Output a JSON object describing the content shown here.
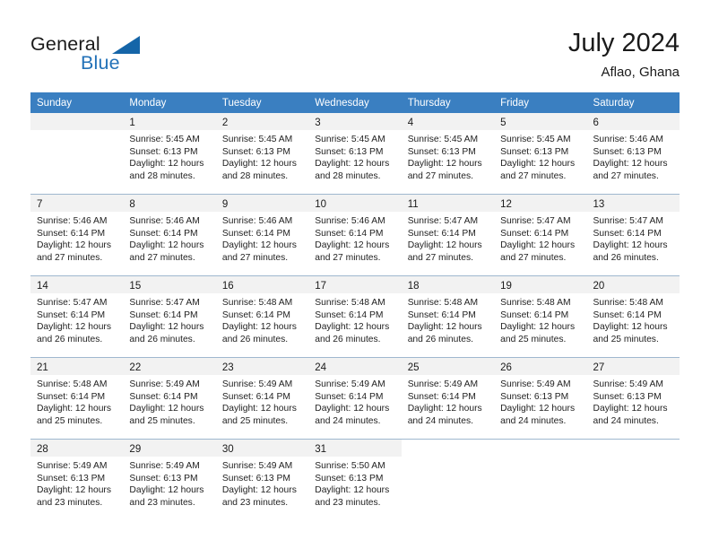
{
  "brand": {
    "word1": "General",
    "word2": "Blue",
    "logo_icon": "triangle-logo-icon",
    "accent_color": "#2372b8"
  },
  "header": {
    "title": "July 2024",
    "location": "Aflao, Ghana"
  },
  "calendar": {
    "header_bg": "#3a7fc1",
    "daynum_bg": "#f2f2f2",
    "weekday_names": [
      "Sunday",
      "Monday",
      "Tuesday",
      "Wednesday",
      "Thursday",
      "Friday",
      "Saturday"
    ],
    "weeks": [
      [
        {
          "day": "",
          "sunrise": "",
          "sunset": "",
          "daylight_line1": "",
          "daylight_line2": "",
          "empty": true
        },
        {
          "day": "1",
          "sunrise": "Sunrise: 5:45 AM",
          "sunset": "Sunset: 6:13 PM",
          "daylight_line1": "Daylight: 12 hours",
          "daylight_line2": "and 28 minutes."
        },
        {
          "day": "2",
          "sunrise": "Sunrise: 5:45 AM",
          "sunset": "Sunset: 6:13 PM",
          "daylight_line1": "Daylight: 12 hours",
          "daylight_line2": "and 28 minutes."
        },
        {
          "day": "3",
          "sunrise": "Sunrise: 5:45 AM",
          "sunset": "Sunset: 6:13 PM",
          "daylight_line1": "Daylight: 12 hours",
          "daylight_line2": "and 28 minutes."
        },
        {
          "day": "4",
          "sunrise": "Sunrise: 5:45 AM",
          "sunset": "Sunset: 6:13 PM",
          "daylight_line1": "Daylight: 12 hours",
          "daylight_line2": "and 27 minutes."
        },
        {
          "day": "5",
          "sunrise": "Sunrise: 5:45 AM",
          "sunset": "Sunset: 6:13 PM",
          "daylight_line1": "Daylight: 12 hours",
          "daylight_line2": "and 27 minutes."
        },
        {
          "day": "6",
          "sunrise": "Sunrise: 5:46 AM",
          "sunset": "Sunset: 6:13 PM",
          "daylight_line1": "Daylight: 12 hours",
          "daylight_line2": "and 27 minutes."
        }
      ],
      [
        {
          "day": "7",
          "sunrise": "Sunrise: 5:46 AM",
          "sunset": "Sunset: 6:14 PM",
          "daylight_line1": "Daylight: 12 hours",
          "daylight_line2": "and 27 minutes."
        },
        {
          "day": "8",
          "sunrise": "Sunrise: 5:46 AM",
          "sunset": "Sunset: 6:14 PM",
          "daylight_line1": "Daylight: 12 hours",
          "daylight_line2": "and 27 minutes."
        },
        {
          "day": "9",
          "sunrise": "Sunrise: 5:46 AM",
          "sunset": "Sunset: 6:14 PM",
          "daylight_line1": "Daylight: 12 hours",
          "daylight_line2": "and 27 minutes."
        },
        {
          "day": "10",
          "sunrise": "Sunrise: 5:46 AM",
          "sunset": "Sunset: 6:14 PM",
          "daylight_line1": "Daylight: 12 hours",
          "daylight_line2": "and 27 minutes."
        },
        {
          "day": "11",
          "sunrise": "Sunrise: 5:47 AM",
          "sunset": "Sunset: 6:14 PM",
          "daylight_line1": "Daylight: 12 hours",
          "daylight_line2": "and 27 minutes."
        },
        {
          "day": "12",
          "sunrise": "Sunrise: 5:47 AM",
          "sunset": "Sunset: 6:14 PM",
          "daylight_line1": "Daylight: 12 hours",
          "daylight_line2": "and 27 minutes."
        },
        {
          "day": "13",
          "sunrise": "Sunrise: 5:47 AM",
          "sunset": "Sunset: 6:14 PM",
          "daylight_line1": "Daylight: 12 hours",
          "daylight_line2": "and 26 minutes."
        }
      ],
      [
        {
          "day": "14",
          "sunrise": "Sunrise: 5:47 AM",
          "sunset": "Sunset: 6:14 PM",
          "daylight_line1": "Daylight: 12 hours",
          "daylight_line2": "and 26 minutes."
        },
        {
          "day": "15",
          "sunrise": "Sunrise: 5:47 AM",
          "sunset": "Sunset: 6:14 PM",
          "daylight_line1": "Daylight: 12 hours",
          "daylight_line2": "and 26 minutes."
        },
        {
          "day": "16",
          "sunrise": "Sunrise: 5:48 AM",
          "sunset": "Sunset: 6:14 PM",
          "daylight_line1": "Daylight: 12 hours",
          "daylight_line2": "and 26 minutes."
        },
        {
          "day": "17",
          "sunrise": "Sunrise: 5:48 AM",
          "sunset": "Sunset: 6:14 PM",
          "daylight_line1": "Daylight: 12 hours",
          "daylight_line2": "and 26 minutes."
        },
        {
          "day": "18",
          "sunrise": "Sunrise: 5:48 AM",
          "sunset": "Sunset: 6:14 PM",
          "daylight_line1": "Daylight: 12 hours",
          "daylight_line2": "and 26 minutes."
        },
        {
          "day": "19",
          "sunrise": "Sunrise: 5:48 AM",
          "sunset": "Sunset: 6:14 PM",
          "daylight_line1": "Daylight: 12 hours",
          "daylight_line2": "and 25 minutes."
        },
        {
          "day": "20",
          "sunrise": "Sunrise: 5:48 AM",
          "sunset": "Sunset: 6:14 PM",
          "daylight_line1": "Daylight: 12 hours",
          "daylight_line2": "and 25 minutes."
        }
      ],
      [
        {
          "day": "21",
          "sunrise": "Sunrise: 5:48 AM",
          "sunset": "Sunset: 6:14 PM",
          "daylight_line1": "Daylight: 12 hours",
          "daylight_line2": "and 25 minutes."
        },
        {
          "day": "22",
          "sunrise": "Sunrise: 5:49 AM",
          "sunset": "Sunset: 6:14 PM",
          "daylight_line1": "Daylight: 12 hours",
          "daylight_line2": "and 25 minutes."
        },
        {
          "day": "23",
          "sunrise": "Sunrise: 5:49 AM",
          "sunset": "Sunset: 6:14 PM",
          "daylight_line1": "Daylight: 12 hours",
          "daylight_line2": "and 25 minutes."
        },
        {
          "day": "24",
          "sunrise": "Sunrise: 5:49 AM",
          "sunset": "Sunset: 6:14 PM",
          "daylight_line1": "Daylight: 12 hours",
          "daylight_line2": "and 24 minutes."
        },
        {
          "day": "25",
          "sunrise": "Sunrise: 5:49 AM",
          "sunset": "Sunset: 6:14 PM",
          "daylight_line1": "Daylight: 12 hours",
          "daylight_line2": "and 24 minutes."
        },
        {
          "day": "26",
          "sunrise": "Sunrise: 5:49 AM",
          "sunset": "Sunset: 6:13 PM",
          "daylight_line1": "Daylight: 12 hours",
          "daylight_line2": "and 24 minutes."
        },
        {
          "day": "27",
          "sunrise": "Sunrise: 5:49 AM",
          "sunset": "Sunset: 6:13 PM",
          "daylight_line1": "Daylight: 12 hours",
          "daylight_line2": "and 24 minutes."
        }
      ],
      [
        {
          "day": "28",
          "sunrise": "Sunrise: 5:49 AM",
          "sunset": "Sunset: 6:13 PM",
          "daylight_line1": "Daylight: 12 hours",
          "daylight_line2": "and 23 minutes."
        },
        {
          "day": "29",
          "sunrise": "Sunrise: 5:49 AM",
          "sunset": "Sunset: 6:13 PM",
          "daylight_line1": "Daylight: 12 hours",
          "daylight_line2": "and 23 minutes."
        },
        {
          "day": "30",
          "sunrise": "Sunrise: 5:49 AM",
          "sunset": "Sunset: 6:13 PM",
          "daylight_line1": "Daylight: 12 hours",
          "daylight_line2": "and 23 minutes."
        },
        {
          "day": "31",
          "sunrise": "Sunrise: 5:50 AM",
          "sunset": "Sunset: 6:13 PM",
          "daylight_line1": "Daylight: 12 hours",
          "daylight_line2": "and 23 minutes."
        },
        {
          "day": "",
          "sunrise": "",
          "sunset": "",
          "daylight_line1": "",
          "daylight_line2": "",
          "blank": true
        },
        {
          "day": "",
          "sunrise": "",
          "sunset": "",
          "daylight_line1": "",
          "daylight_line2": "",
          "blank": true
        },
        {
          "day": "",
          "sunrise": "",
          "sunset": "",
          "daylight_line1": "",
          "daylight_line2": "",
          "blank": true
        }
      ]
    ]
  }
}
